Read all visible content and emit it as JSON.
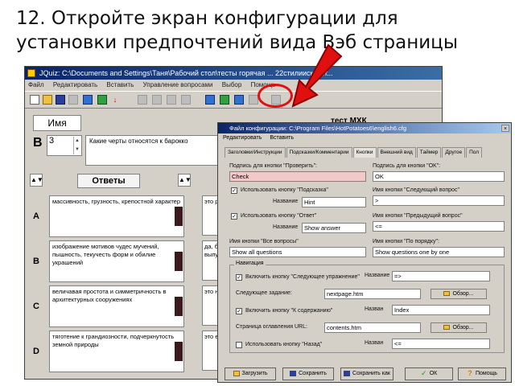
{
  "slide": {
    "title": "12. Откройте экран конфигурации для установки предпочтений вида Вэб страницы"
  },
  "main_window": {
    "title": "JQuiz: C:\\Documents and Settings\\Таня\\Рабочий стол\\тесты горячая ... 22стилиискусст...",
    "menu": [
      "Файл",
      "Редактировать",
      "Вставить",
      "Управление вопросами",
      "Выбор",
      "Помощь"
    ],
    "name_label": "Имя",
    "test_name": "тест МХК",
    "b_label": "В",
    "question_number": "3",
    "question_text": "Какие черты относятся к барокко",
    "answers_label": "Ответы",
    "answers": [
      {
        "letter": "A",
        "text": "массивность, грузность, крепостной характер",
        "side": "это р"
      },
      {
        "letter": "B",
        "text": "изображение мотивов чудес мучений, пышность, текучесть форм и обилие украшений",
        "side": "да, б выпу"
      },
      {
        "letter": "C",
        "text": "величавая простота и симметричность в архитектурных сооружениях",
        "side": "это н"
      },
      {
        "letter": "D",
        "text": "тяготение к грандиозности, подчеркнутость земной природы",
        "side": "это е"
      }
    ]
  },
  "config_dialog": {
    "title": "Файл конфигурации: C:\\Program Files\\HotPotatoes6\\english6.cfg",
    "menu": [
      "Редактировать",
      "Вставить"
    ],
    "tabs": [
      "Заголовки/Инструкции",
      "Подсказки/Комментарии",
      "Кнопки",
      "Внешний вид",
      "Таймер",
      "Другое",
      "Пол"
    ],
    "check_caption_label": "Подпись для кнопки \"Проверить\":",
    "check_caption_value": "Check",
    "ok_caption_label": "Подпись для кнопки \"OK\":",
    "ok_caption_value": "OK",
    "hint_checkbox_label": "Использовать кнопку \"Подсказка\"",
    "hint_name_label": "Название",
    "hint_name_value": "Hint",
    "next_q_label": "Имя кнопки \"Следующий вопрос\"",
    "next_q_value": ">",
    "show_answer_checkbox_label": "Использовать кнопку \"Ответ\"",
    "show_answer_name_label": "Название",
    "show_answer_value": "Show answer",
    "prev_q_label": "Имя кнопки \"Предыдущий вопрос\"",
    "prev_q_value": "<=",
    "all_q_label": "Имя кнопки \"Все вопросы\"",
    "all_q_value": "Show all questions",
    "one_by_one_label": "Имя кнопки \"По порядку\":",
    "one_by_one_value": "Show questions one by one",
    "nav_group_title": "Навигация",
    "next_ex_checkbox_label": "Включить кнопку \"Следующее упражнение\"",
    "next_ex_name_label": "Название",
    "next_ex_name_value": "=>",
    "next_ex_page_label": "Следующее задание:",
    "next_ex_page_value": "nextpage.htm",
    "browse_label": "Обзор...",
    "contents_checkbox_label": "Включить кнопку \"К содержанию\"",
    "contents_name_label": "Назван",
    "contents_name_value": "Index",
    "contents_url_label": "Страница оглавления URL:",
    "contents_url_value": "contents.htm",
    "back_checkbox_label": "Использовать кнопку \"Назад\"",
    "back_name_label": "Назван",
    "back_name_value": "<=",
    "buttons": {
      "load": "Загрузить",
      "save": "Сохранить",
      "save_as": "Сохранить как",
      "ok": "ОК",
      "help": "Помощь"
    }
  },
  "colors": {
    "title_blue": "#0a246a",
    "annotation_red": "#e01010",
    "pink_field": "#f3c8c8"
  }
}
